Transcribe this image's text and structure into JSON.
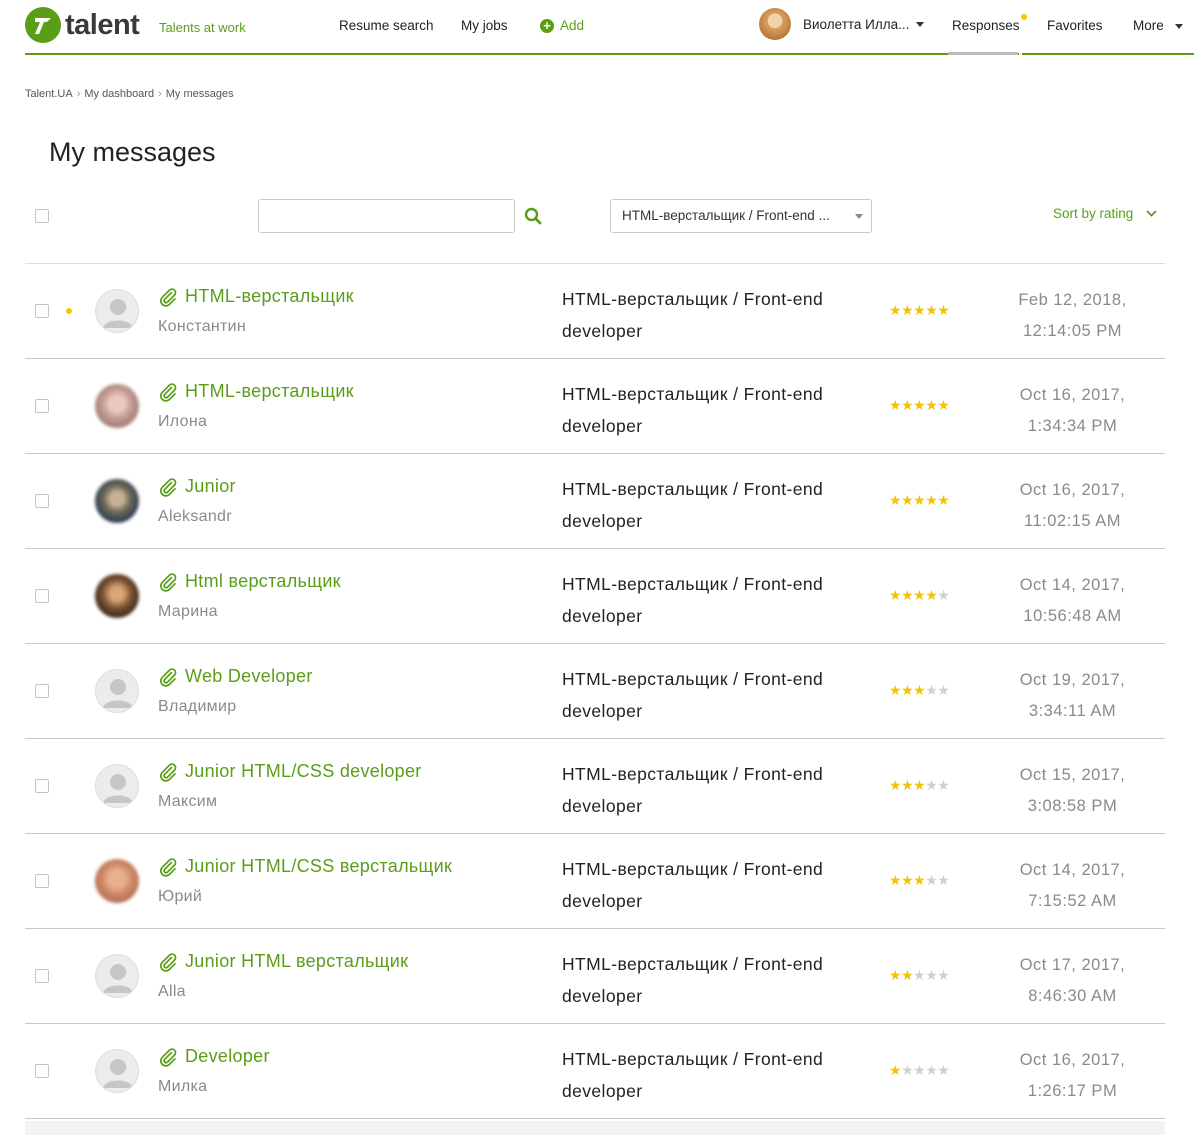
{
  "header": {
    "logo_text": "talent",
    "tagline": "Talents at work",
    "nav": {
      "resume_search": "Resume search",
      "my_jobs": "My jobs",
      "add": "Add"
    },
    "user_name": "Виолетта Илла...",
    "tabs": {
      "responses": "Responses",
      "favorites": "Favorites",
      "more": "More"
    },
    "accent_color": "#5a9e17"
  },
  "breadcrumb": [
    "Talent.UA",
    "My dashboard",
    "My messages"
  ],
  "page_title": "My messages",
  "toolbar": {
    "search_value": "",
    "job_filter": "HTML-верстальщик / Front-end ...",
    "sort_label": "Sort by rating"
  },
  "messages": [
    {
      "title": "HTML-верстальщик",
      "name": "Константин",
      "job_line1": "HTML-верстальщик / Front-end",
      "job_line2": "developer",
      "rating": 5,
      "date_line1": "Feb 12, 2018,",
      "date_line2": "12:14:05 PM",
      "unread": true,
      "avatar": "default"
    },
    {
      "title": "HTML-верстальщик",
      "name": "Илона",
      "job_line1": "HTML-верстальщик / Front-end",
      "job_line2": "developer",
      "rating": 5,
      "date_line1": "Oct 16, 2017,",
      "date_line2": "1:34:34 PM",
      "unread": false,
      "avatar": "photo-light"
    },
    {
      "title": "Junior",
      "name": "Aleksandr",
      "job_line1": "HTML-верстальщик / Front-end",
      "job_line2": "developer",
      "rating": 5,
      "date_line1": "Oct 16, 2017,",
      "date_line2": "11:02:15 AM",
      "unread": false,
      "avatar": "photo-blue"
    },
    {
      "title": "Html верстальщик",
      "name": "Марина",
      "job_line1": "HTML-верстальщик / Front-end",
      "job_line2": "developer",
      "rating": 4,
      "date_line1": "Oct 14, 2017,",
      "date_line2": "10:56:48 AM",
      "unread": false,
      "avatar": "photo-dark"
    },
    {
      "title": "Web Developer",
      "name": "Владимир",
      "job_line1": "HTML-верстальщик / Front-end",
      "job_line2": "developer",
      "rating": 3,
      "date_line1": "Oct 19, 2017,",
      "date_line2": "3:34:11 AM",
      "unread": false,
      "avatar": "default"
    },
    {
      "title": "Junior HTML/CSS developer",
      "name": "Максим",
      "job_line1": "HTML-верстальщик / Front-end",
      "job_line2": "developer",
      "rating": 3,
      "date_line1": "Oct 15, 2017,",
      "date_line2": "3:08:58 PM",
      "unread": false,
      "avatar": "default"
    },
    {
      "title": "Junior HTML/CSS верстальщик",
      "name": "Юрий",
      "job_line1": "HTML-верстальщик / Front-end",
      "job_line2": "developer",
      "rating": 3,
      "date_line1": "Oct 14, 2017,",
      "date_line2": "7:15:52 AM",
      "unread": false,
      "avatar": "photo-warm"
    },
    {
      "title": "Junior HTML верстальщик",
      "name": "Alla",
      "job_line1": "HTML-верстальщик / Front-end",
      "job_line2": "developer",
      "rating": 2,
      "date_line1": "Oct 17, 2017,",
      "date_line2": "8:46:30 AM",
      "unread": false,
      "avatar": "default"
    },
    {
      "title": "Developer",
      "name": "Милка",
      "job_line1": "HTML-верстальщик / Front-end",
      "job_line2": "developer",
      "rating": 1,
      "date_line1": "Oct 16, 2017,",
      "date_line2": "1:26:17 PM",
      "unread": false,
      "avatar": "default"
    }
  ]
}
